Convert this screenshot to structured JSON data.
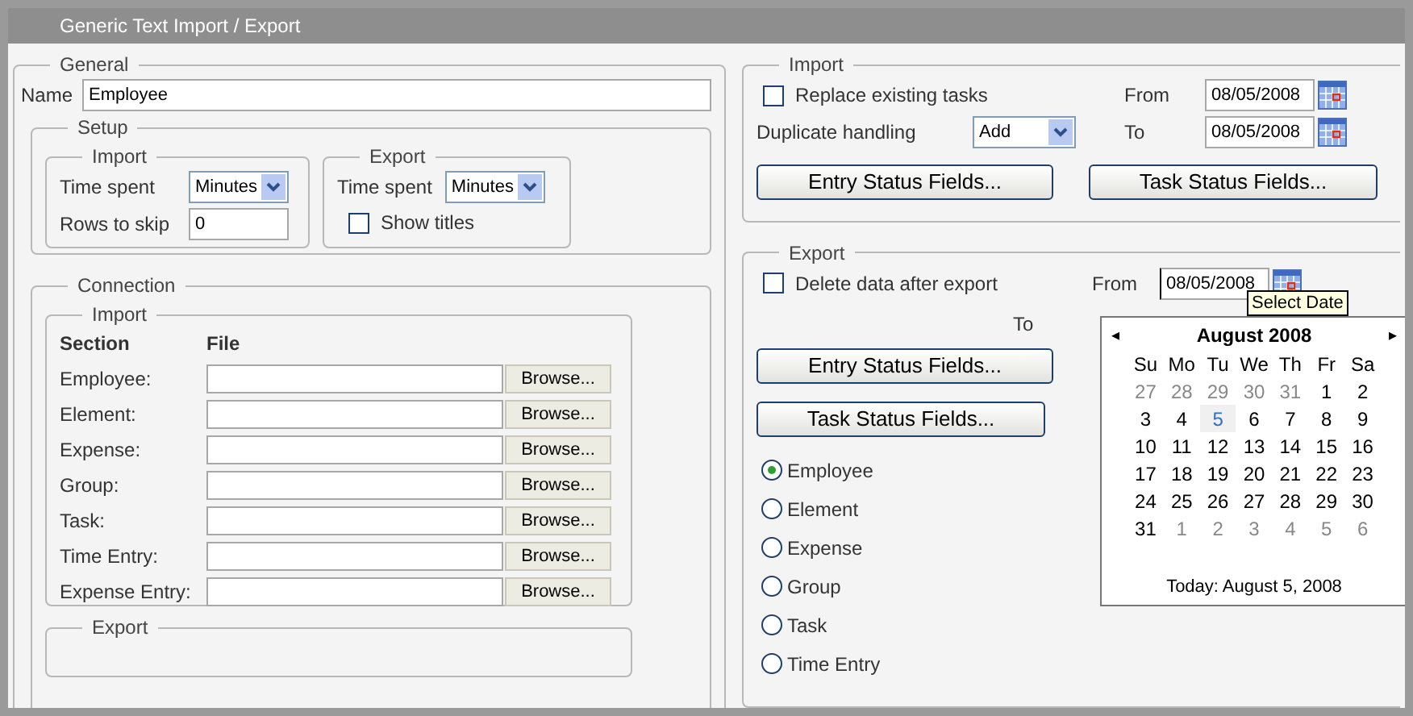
{
  "window": {
    "title": "Generic Text Import / Export"
  },
  "general": {
    "legend": "General",
    "name_label": "Name",
    "name_value": "Employee",
    "setup": {
      "legend": "Setup",
      "import": {
        "legend": "Import",
        "time_spent_label": "Time spent",
        "time_spent_value": "Minutes",
        "rows_to_skip_label": "Rows to skip",
        "rows_to_skip_value": "0"
      },
      "export": {
        "legend": "Export",
        "time_spent_label": "Time spent",
        "time_spent_value": "Minutes",
        "show_titles": {
          "label": "Show titles",
          "checked": false
        }
      }
    },
    "connection": {
      "legend": "Connection",
      "import": {
        "legend": "Import",
        "columns": [
          "Section",
          "File"
        ],
        "rows": [
          {
            "section": "Employee:",
            "button": "Browse..."
          },
          {
            "section": "Element:",
            "button": "Browse..."
          },
          {
            "section": "Expense:",
            "button": "Browse..."
          },
          {
            "section": "Group:",
            "button": "Browse..."
          },
          {
            "section": "Task:",
            "button": "Browse..."
          },
          {
            "section": "Time Entry:",
            "button": "Browse..."
          },
          {
            "section": "Expense Entry:",
            "button": "Browse..."
          }
        ]
      },
      "export": {
        "legend": "Export"
      }
    }
  },
  "import": {
    "legend": "Import",
    "replace_existing": {
      "label": "Replace existing tasks",
      "checked": false
    },
    "duplicate_label": "Duplicate handling",
    "duplicate_value": "Add",
    "from_label": "From",
    "from_value": "08/05/2008",
    "to_label": "To",
    "to_value": "08/05/2008",
    "buttons": [
      "Entry Status Fields...",
      "Task Status Fields..."
    ]
  },
  "export": {
    "legend": "Export",
    "delete_after": {
      "label": "Delete data after export",
      "checked": false
    },
    "from_label": "From",
    "from_value": "08/05/2008",
    "to_label": "To",
    "buttons": [
      "Entry Status Fields...",
      "Task Status Fields..."
    ],
    "sections": [
      {
        "label": "Employee",
        "selected": true
      },
      {
        "label": "Element",
        "selected": false
      },
      {
        "label": "Expense",
        "selected": false
      },
      {
        "label": "Group",
        "selected": false
      },
      {
        "label": "Task",
        "selected": false
      },
      {
        "label": "Time Entry",
        "selected": false
      }
    ]
  },
  "calendar": {
    "prev": "◂",
    "month": "August 2008",
    "next": "▸",
    "tooltip": "Select Date",
    "weekdays": [
      "Su",
      "Mo",
      "Tu",
      "We",
      "Th",
      "Fr",
      "Sa"
    ],
    "days": [
      {
        "label": "27",
        "other_month": true,
        "today": false
      },
      {
        "label": "28",
        "other_month": true,
        "today": false
      },
      {
        "label": "29",
        "other_month": true,
        "today": false
      },
      {
        "label": "30",
        "other_month": true,
        "today": false
      },
      {
        "label": "31",
        "other_month": true,
        "today": false
      },
      {
        "label": "1",
        "other_month": false,
        "today": false
      },
      {
        "label": "2",
        "other_month": false,
        "today": false
      },
      {
        "label": "3",
        "other_month": false,
        "today": false
      },
      {
        "label": "4",
        "other_month": false,
        "today": false
      },
      {
        "label": "5",
        "other_month": false,
        "today": true
      },
      {
        "label": "6",
        "other_month": false,
        "today": false
      },
      {
        "label": "7",
        "other_month": false,
        "today": false
      },
      {
        "label": "8",
        "other_month": false,
        "today": false
      },
      {
        "label": "9",
        "other_month": false,
        "today": false
      },
      {
        "label": "10",
        "other_month": false,
        "today": false
      },
      {
        "label": "11",
        "other_month": false,
        "today": false
      },
      {
        "label": "12",
        "other_month": false,
        "today": false
      },
      {
        "label": "13",
        "other_month": false,
        "today": false
      },
      {
        "label": "14",
        "other_month": false,
        "today": false
      },
      {
        "label": "15",
        "other_month": false,
        "today": false
      },
      {
        "label": "16",
        "other_month": false,
        "today": false
      },
      {
        "label": "17",
        "other_month": false,
        "today": false
      },
      {
        "label": "18",
        "other_month": false,
        "today": false
      },
      {
        "label": "19",
        "other_month": false,
        "today": false
      },
      {
        "label": "20",
        "other_month": false,
        "today": false
      },
      {
        "label": "21",
        "other_month": false,
        "today": false
      },
      {
        "label": "22",
        "other_month": false,
        "today": false
      },
      {
        "label": "23",
        "other_month": false,
        "today": false
      },
      {
        "label": "24",
        "other_month": false,
        "today": false
      },
      {
        "label": "25",
        "other_month": false,
        "today": false
      },
      {
        "label": "26",
        "other_month": false,
        "today": false
      },
      {
        "label": "27",
        "other_month": false,
        "today": false
      },
      {
        "label": "28",
        "other_month": false,
        "today": false
      },
      {
        "label": "29",
        "other_month": false,
        "today": false
      },
      {
        "label": "30",
        "other_month": false,
        "today": false
      },
      {
        "label": "31",
        "other_month": false,
        "today": false
      },
      {
        "label": "1",
        "other_month": true,
        "today": false
      },
      {
        "label": "2",
        "other_month": true,
        "today": false
      },
      {
        "label": "3",
        "other_month": true,
        "today": false
      },
      {
        "label": "4",
        "other_month": true,
        "today": false
      },
      {
        "label": "5",
        "other_month": true,
        "today": false
      },
      {
        "label": "6",
        "other_month": true,
        "today": false
      }
    ],
    "today_text": "Today: August 5, 2008"
  }
}
